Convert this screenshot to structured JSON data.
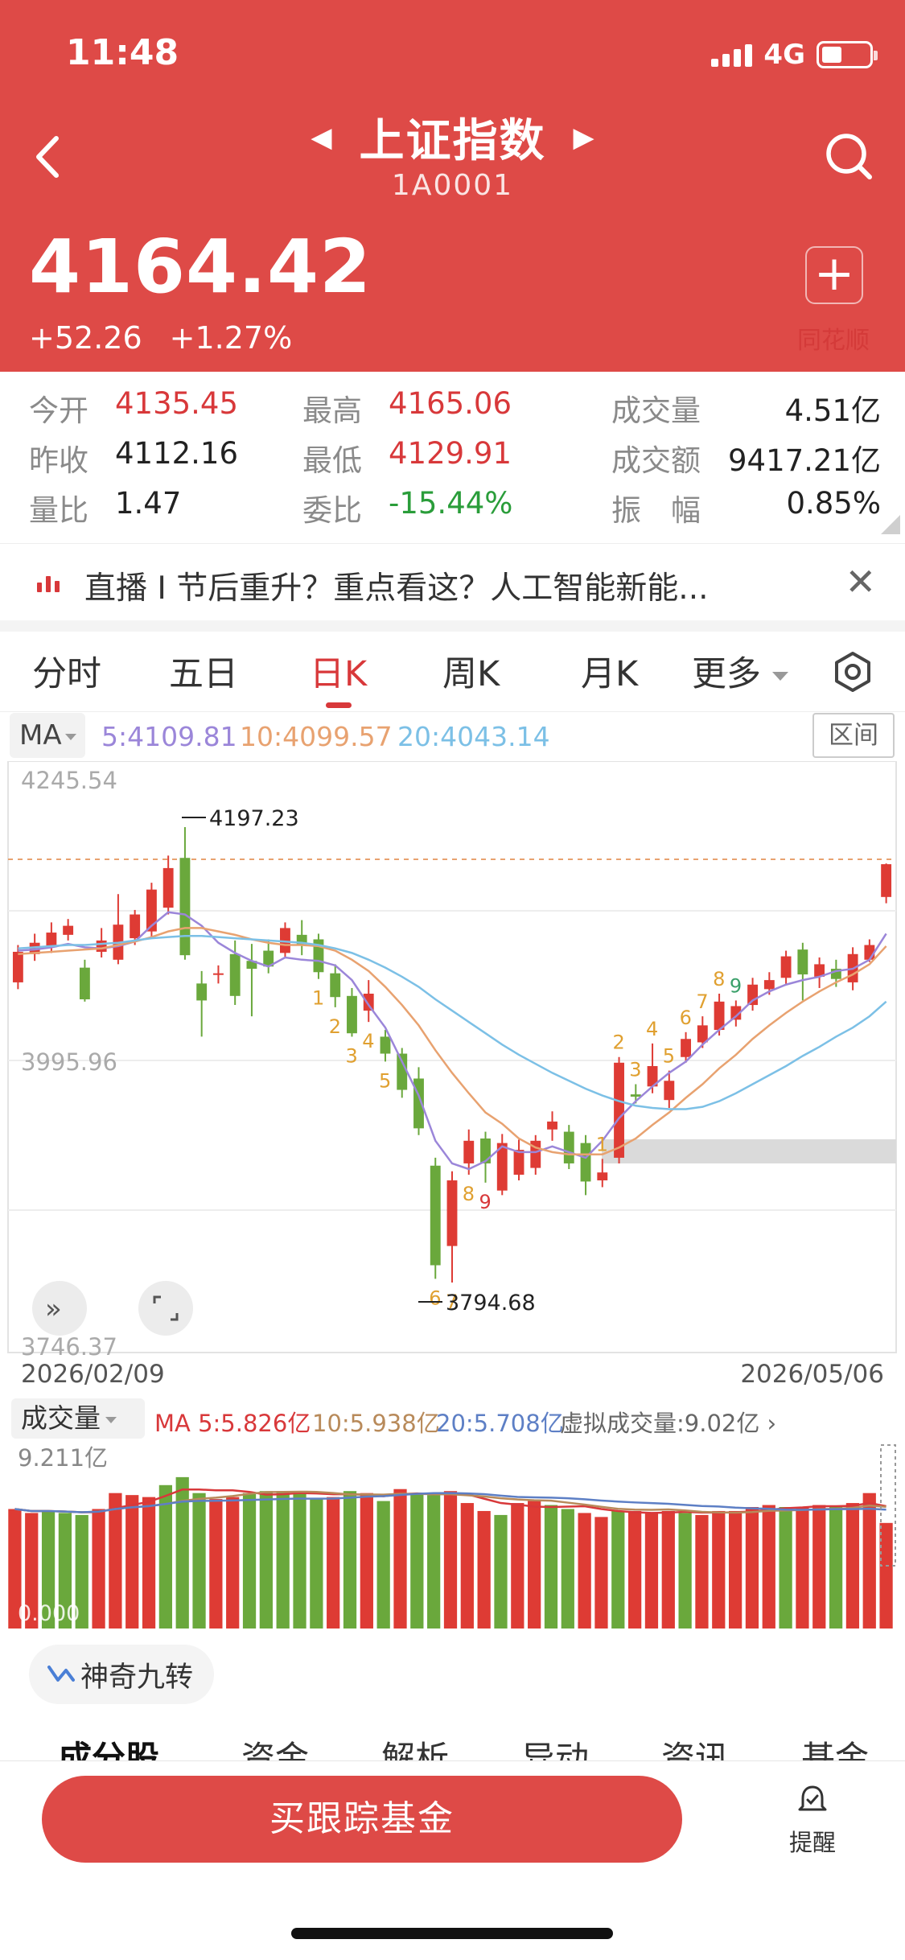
{
  "status": {
    "time": "11:48",
    "network": "4G"
  },
  "header": {
    "title": "上证指数",
    "code": "1A0001",
    "price": "4164.42",
    "change": "+52.26",
    "change_pct": "+1.27%",
    "add_label": "+",
    "watermark": "同花顺"
  },
  "stats": {
    "open_label": "今开",
    "open_value": "4135.45",
    "high_label": "最高",
    "high_value": "4165.06",
    "volume_label": "成交量",
    "volume_value": "4.51亿",
    "prev_close_label": "昨收",
    "prev_close_value": "4112.16",
    "low_label": "最低",
    "low_value": "4129.91",
    "amount_label": "成交额",
    "amount_value": "9417.21亿",
    "vol_ratio_label": "量比",
    "vol_ratio_value": "1.47",
    "commission_label": "委比",
    "commission_value": "-15.44%",
    "amplitude_label": "振　幅",
    "amplitude_value": "0.85%"
  },
  "banner": {
    "text": "直播 I 节后重升？重点看这？人工智能新能..."
  },
  "tabs": [
    "分时",
    "五日",
    "日K",
    "周K",
    "月K",
    "更多"
  ],
  "ma": {
    "selector": "MA",
    "ma5": "5:4109.81",
    "ma10": "10:4099.57",
    "ma20": "20:4043.14",
    "range_button": "区间"
  },
  "colors": {
    "up": "#de3b34",
    "down": "#6aa83c",
    "ma5": "#9b86d9",
    "ma10": "#e8a270",
    "ma20": "#7cc0e6",
    "header_bg": "#de4a47"
  },
  "kline": {
    "y_top_label": "4245.54",
    "y_mid_label": "3995.96",
    "y_bottom_label": "3746.37",
    "high_marker": "4197.23",
    "low_marker": "3794.68",
    "start_date": "2026/02/09",
    "end_date": "2026/05/06",
    "nine_turn_labels": [
      "1",
      "2",
      "3",
      "4",
      "5",
      "6",
      "7",
      "8",
      "9",
      "1",
      "2",
      "3",
      "4",
      "5",
      "6",
      "7",
      "8",
      "9"
    ]
  },
  "volume": {
    "selector": "成交量",
    "ma5": "MA 5:5.826亿",
    "ma10": "10:5.938亿",
    "ma20": "20:5.708亿",
    "virtual": "虚拟成交量:9.02亿",
    "y_top_label": "9.211亿",
    "y_bottom_label": "0.000"
  },
  "magic_button": "神奇九转",
  "bottom_tabs": [
    "成分股",
    "资金",
    "解析",
    "异动",
    "资讯",
    "基金"
  ],
  "footer": {
    "buy_label": "买跟踪基金",
    "remind_label": "提醒"
  },
  "chart_data": {
    "type": "candlestick",
    "y_range": [
      3746.37,
      4245.54
    ],
    "x_range": [
      "2026/02/09",
      "2026/05/06"
    ],
    "candles": [
      {
        "o": 4060,
        "c": 4087,
        "h": 4093,
        "l": 4054
      },
      {
        "o": 4085,
        "c": 4095,
        "h": 4103,
        "l": 4079
      },
      {
        "o": 4091,
        "c": 4104,
        "h": 4113,
        "l": 4086
      },
      {
        "o": 4102,
        "c": 4110,
        "h": 4116,
        "l": 4097
      },
      {
        "o": 4073,
        "c": 4045,
        "h": 4080,
        "l": 4043
      },
      {
        "o": 4087,
        "c": 4097,
        "h": 4108,
        "l": 4082
      },
      {
        "o": 4080,
        "c": 4111,
        "h": 4138,
        "l": 4076
      },
      {
        "o": 4099,
        "c": 4120,
        "h": 4124,
        "l": 4093
      },
      {
        "o": 4105,
        "c": 4142,
        "h": 4148,
        "l": 4099
      },
      {
        "o": 4126,
        "c": 4161,
        "h": 4172,
        "l": 4120
      },
      {
        "o": 4170,
        "c": 4084,
        "h": 4197.23,
        "l": 4080
      },
      {
        "o": 4059,
        "c": 4044,
        "h": 4070,
        "l": 4012
      },
      {
        "o": 4068,
        "c": 4068,
        "h": 4075,
        "l": 4059
      },
      {
        "o": 4085,
        "c": 4048,
        "h": 4097,
        "l": 4040
      },
      {
        "o": 4079,
        "c": 4072,
        "h": 4094,
        "l": 4030
      },
      {
        "o": 4088,
        "c": 4074,
        "h": 4098,
        "l": 4068
      },
      {
        "o": 4086,
        "c": 4108,
        "h": 4113,
        "l": 4082
      },
      {
        "o": 4102,
        "c": 4093,
        "h": 4115,
        "l": 4084
      },
      {
        "o": 4098,
        "c": 4069,
        "h": 4103,
        "l": 4063
      },
      {
        "o": 4068,
        "c": 4047,
        "h": 4076,
        "l": 4038
      },
      {
        "o": 4048,
        "c": 4015,
        "h": 4055,
        "l": 4012
      },
      {
        "o": 4035,
        "c": 4050,
        "h": 4062,
        "l": 4025
      },
      {
        "o": 4012,
        "c": 3997,
        "h": 4018,
        "l": 3990
      },
      {
        "o": 3997,
        "c": 3965,
        "h": 4002,
        "l": 3958
      },
      {
        "o": 3975,
        "c": 3931,
        "h": 3985,
        "l": 3925
      },
      {
        "o": 3898,
        "c": 3810,
        "h": 3905,
        "l": 3798
      },
      {
        "o": 3827,
        "c": 3885,
        "h": 3893,
        "l": 3794.68
      },
      {
        "o": 3900,
        "c": 3920,
        "h": 3930,
        "l": 3890
      },
      {
        "o": 3922,
        "c": 3900,
        "h": 3928,
        "l": 3883
      },
      {
        "o": 3876,
        "c": 3918,
        "h": 3926,
        "l": 3872
      },
      {
        "o": 3890,
        "c": 3912,
        "h": 3921,
        "l": 3885
      },
      {
        "o": 3896,
        "c": 3920,
        "h": 3925,
        "l": 3890
      },
      {
        "o": 3930,
        "c": 3937,
        "h": 3946,
        "l": 3920
      },
      {
        "o": 3928,
        "c": 3900,
        "h": 3934,
        "l": 3895
      },
      {
        "o": 3918,
        "c": 3884,
        "h": 3925,
        "l": 3872
      },
      {
        "o": 3885,
        "c": 3892,
        "h": 3904,
        "l": 3879
      },
      {
        "o": 3905,
        "c": 3989,
        "h": 3994,
        "l": 3900
      },
      {
        "o": 3961,
        "c": 3959,
        "h": 3970,
        "l": 3953
      },
      {
        "o": 3968,
        "c": 3986,
        "h": 4006,
        "l": 3962
      },
      {
        "o": 3956,
        "c": 3973,
        "h": 3982,
        "l": 3949
      },
      {
        "o": 3994,
        "c": 4010,
        "h": 4016,
        "l": 3989
      },
      {
        "o": 4007,
        "c": 4022,
        "h": 4030,
        "l": 4002
      },
      {
        "o": 4018,
        "c": 4043,
        "h": 4050,
        "l": 4013
      },
      {
        "o": 4027,
        "c": 4039,
        "h": 4044,
        "l": 4021
      },
      {
        "o": 4040,
        "c": 4058,
        "h": 4064,
        "l": 4035
      },
      {
        "o": 4054,
        "c": 4062,
        "h": 4069,
        "l": 4049
      },
      {
        "o": 4064,
        "c": 4083,
        "h": 4088,
        "l": 4058
      },
      {
        "o": 4089,
        "c": 4067,
        "h": 4095,
        "l": 4044
      },
      {
        "o": 4065,
        "c": 4076,
        "h": 4082,
        "l": 4055
      },
      {
        "o": 4072,
        "c": 4063,
        "h": 4080,
        "l": 4056
      },
      {
        "o": 4060,
        "c": 4085,
        "h": 4091,
        "l": 4053
      },
      {
        "o": 4080,
        "c": 4093,
        "h": 4098,
        "l": 4078
      },
      {
        "o": 4135.45,
        "c": 4164.42,
        "h": 4165.06,
        "l": 4129.91
      }
    ],
    "ma5": [
      4088,
      4089,
      4091,
      4094,
      4091,
      4090,
      4092,
      4096,
      4110,
      4122,
      4120,
      4110,
      4095,
      4086,
      4079,
      4074,
      4082,
      4080,
      4079,
      4075,
      4062,
      4040,
      4020,
      3990,
      3960,
      3920,
      3900,
      3895,
      3902,
      3915,
      3910,
      3910,
      3915,
      3910,
      3905,
      3920,
      3940,
      3955,
      3968,
      3980,
      3990,
      4005,
      4018,
      4030,
      4044,
      4052,
      4058,
      4062,
      4065,
      4070,
      4072,
      4080,
      4103
    ],
    "ma10": [
      4085,
      4086,
      4087,
      4088,
      4089,
      4090,
      4093,
      4096,
      4100,
      4105,
      4108,
      4108,
      4105,
      4102,
      4098,
      4095,
      4093,
      4093,
      4092,
      4088,
      4080,
      4070,
      4056,
      4040,
      4022,
      4000,
      3980,
      3962,
      3945,
      3935,
      3922,
      3914,
      3910,
      3908,
      3908,
      3908,
      3914,
      3922,
      3934,
      3945,
      3958,
      3970,
      3984,
      3996,
      4010,
      4022,
      4033,
      4043,
      4052,
      4060,
      4067,
      4076,
      4092
    ],
    "ma20": [
      4090,
      4091,
      4092,
      4093,
      4093,
      4094,
      4095,
      4097,
      4099,
      4100,
      4101,
      4101,
      4100,
      4099,
      4098,
      4097,
      4096,
      4095,
      4093,
      4090,
      4086,
      4080,
      4073,
      4065,
      4056,
      4045,
      4035,
      4025,
      4015,
      4005,
      3996,
      3988,
      3980,
      3973,
      3966,
      3960,
      3955,
      3951,
      3949,
      3948,
      3948,
      3950,
      3955,
      3962,
      3970,
      3978,
      3986,
      3995,
      4003,
      4012,
      4020,
      4030,
      4043
    ],
    "volume": {
      "up": [
        true,
        true,
        false,
        false,
        false,
        true,
        true,
        true,
        true,
        false,
        false,
        false,
        true,
        true,
        false,
        false,
        false,
        false,
        false,
        true,
        false,
        true,
        false,
        true,
        false,
        false,
        true,
        true,
        true,
        false,
        true,
        true,
        false,
        false,
        true,
        true,
        false,
        true,
        true,
        true,
        false,
        true,
        true,
        true,
        true,
        true,
        false,
        true,
        true,
        false,
        true,
        true,
        true
      ],
      "values": [
        6.0,
        5.8,
        5.9,
        5.8,
        5.7,
        6.0,
        6.8,
        6.7,
        6.6,
        7.2,
        7.6,
        6.8,
        6.5,
        6.6,
        6.8,
        6.9,
        6.9,
        6.8,
        6.5,
        6.6,
        6.9,
        6.8,
        6.4,
        7.0,
        6.8,
        6.7,
        6.9,
        6.3,
        5.9,
        5.7,
        6.3,
        6.4,
        6.2,
        6.0,
        5.8,
        5.6,
        5.9,
        5.9,
        5.8,
        5.9,
        5.8,
        5.7,
        5.9,
        5.9,
        6.1,
        6.2,
        6.1,
        6.1,
        6.2,
        6.1,
        6.3,
        6.8,
        5.3
      ]
    }
  }
}
